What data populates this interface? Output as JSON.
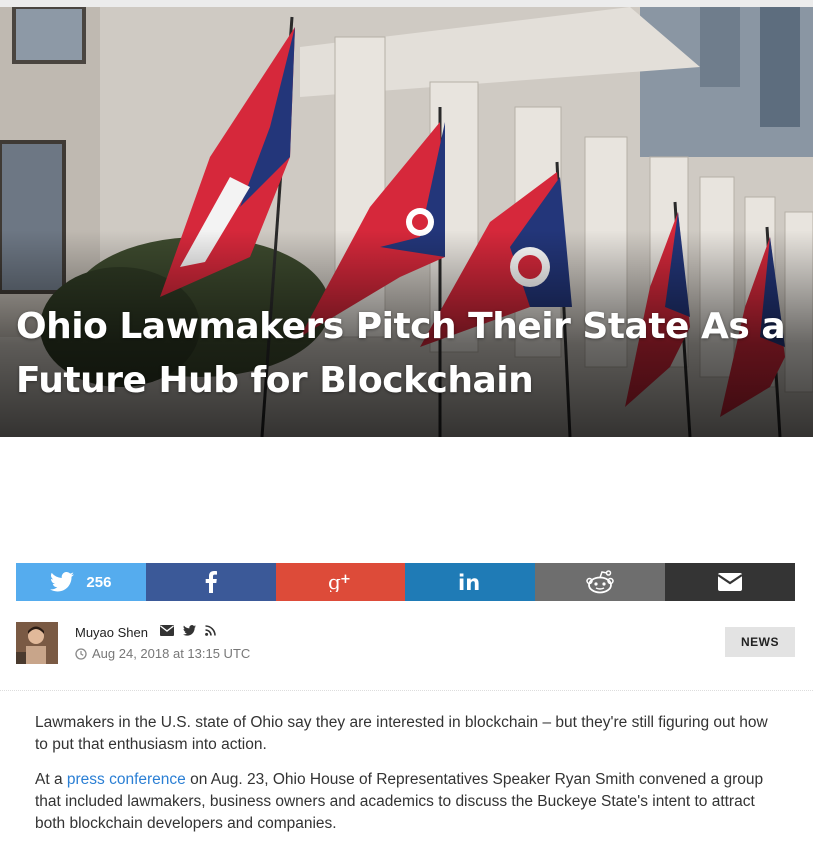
{
  "hero": {
    "title": "Ohio Lawmakers Pitch Their State As a Future Hub for Blockchain"
  },
  "share": {
    "twitter_count": "256",
    "icons": [
      "twitter-icon",
      "facebook-icon",
      "google-plus-icon",
      "linkedin-icon",
      "reddit-icon",
      "email-icon"
    ],
    "colors": {
      "twitter": "#55acee",
      "facebook": "#3b5998",
      "google": "#dd4b39",
      "linkedin": "#1f7bb6",
      "reddit": "#6e6e6e",
      "email": "#343434"
    }
  },
  "author": {
    "name": "Muyao Shen",
    "date": "Aug 24, 2018 at 13:15 UTC",
    "icons": [
      "envelope-icon",
      "twitter-icon",
      "rss-icon",
      "clock-icon"
    ]
  },
  "badge": "NEWS",
  "article": {
    "p1": "Lawmakers in the U.S. state of Ohio say they are interested in blockchain – but they're still figuring out how to put that enthusiasm into action.",
    "p2_before": "At a ",
    "p2_link": "press conference",
    "p2_after": " on Aug. 23, Ohio House of Representatives Speaker Ryan Smith convened a group that included lawmakers, business owners and academics to discuss the Buckeye State's intent to attract both blockchain developers and companies.",
    "link_color": "#2b7fd4"
  }
}
